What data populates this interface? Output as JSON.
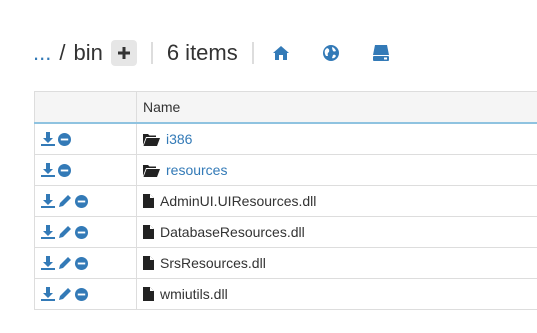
{
  "breadcrumb": {
    "ellipsis": "...",
    "separator": "/",
    "current": "bin"
  },
  "header": {
    "add_icon": "plus-icon",
    "item_count": "6 items",
    "home_icon": "home-icon",
    "globe_icon": "globe-icon",
    "drive_icon": "hdd-icon"
  },
  "table": {
    "columns": [
      "",
      "Name"
    ],
    "rows": [
      {
        "type": "folder",
        "name": "i386",
        "actions": [
          "download",
          "remove"
        ]
      },
      {
        "type": "folder",
        "name": "resources",
        "actions": [
          "download",
          "remove"
        ]
      },
      {
        "type": "file",
        "name": "AdminUI.UIResources.dll",
        "actions": [
          "download",
          "edit",
          "remove"
        ]
      },
      {
        "type": "file",
        "name": "DatabaseResources.dll",
        "actions": [
          "download",
          "edit",
          "remove"
        ]
      },
      {
        "type": "file",
        "name": "SrsResources.dll",
        "actions": [
          "download",
          "edit",
          "remove"
        ]
      },
      {
        "type": "file",
        "name": "wmiutils.dll",
        "actions": [
          "download",
          "edit",
          "remove"
        ]
      }
    ]
  },
  "colors": {
    "link": "#337ab7",
    "header_border": "#8fc3e0",
    "border": "#dddddd"
  }
}
